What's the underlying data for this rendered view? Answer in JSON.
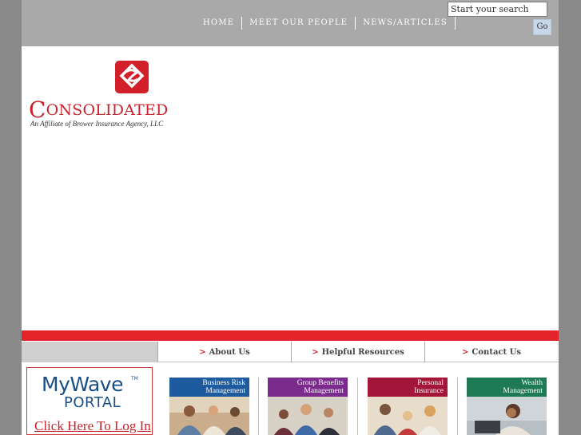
{
  "header": {
    "nav": [
      "HOME",
      "MEET OUR PEOPLE",
      "NEWS/ARTICLES"
    ],
    "search_placeholder": "Start your search",
    "go_label": "Go"
  },
  "logo": {
    "brand_first": "C",
    "brand_rest": "ONSOLIDATED",
    "tagline": "An Affiliate of Brower Insurance Agency, LLC"
  },
  "subnav": {
    "arrow": ">",
    "items": [
      "About Us",
      "Helpful Resources",
      "Contact Us"
    ]
  },
  "mywave": {
    "title": "MyWave",
    "tm": "TM",
    "portal": "PORTAL",
    "login": "Click Here To Log In"
  },
  "cards": [
    {
      "line1": "Business Risk",
      "line2": "Management",
      "color": "#1d5a9e"
    },
    {
      "line1": "Group Benefits",
      "line2": "Management",
      "color": "#7b2b8c"
    },
    {
      "line1": "Personal",
      "line2": "Insurance",
      "color": "#a3163a"
    },
    {
      "line1": "Wealth",
      "line2": "Management",
      "color": "#1e7a55"
    }
  ],
  "colors": {
    "header_gray": "#a9a9a9",
    "accent_red": "#e5232b",
    "brand_red": "#c8232c",
    "mywave_blue": "#1a4f86"
  }
}
